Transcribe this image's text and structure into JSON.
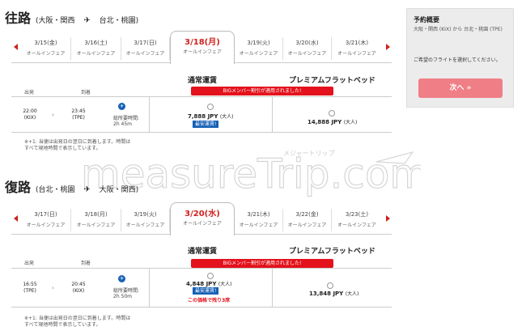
{
  "outbound": {
    "title": "往路",
    "from": "(大阪・関西",
    "arrow": "✈",
    "to": "台北・桃園)",
    "dates": [
      {
        "date": "3/15(金)",
        "fare": "オールインフェア"
      },
      {
        "date": "3/16(土)",
        "fare": "オールインフェア"
      },
      {
        "date": "3/17(日)",
        "fare": "オールインフェア"
      },
      {
        "date": "3/18(月)",
        "fare": "オールインフェア"
      },
      {
        "date": "3/19(火)",
        "fare": "オールインフェア"
      },
      {
        "date": "3/20(水)",
        "fare": "オールインフェア"
      },
      {
        "date": "3/21(木)",
        "fare": "オールインフェア"
      }
    ],
    "fare_normal": "通常運賃",
    "fare_flat": "プレミアムフラットベッド",
    "col_depart": "出発",
    "col_arrive": "到着",
    "promo": "BIGメンバー割引が適用されました!",
    "depart_time": "22:00",
    "depart_code": "(KIX)",
    "arrive_time": "23:45",
    "arrive_code": "(TPE)",
    "dur_label": "総所要時間:",
    "dur_value": "2h 45m",
    "price_normal": "7,888 JPY",
    "price_normal_unit": "(大人)",
    "badge": "最安運賃!",
    "price_flat": "14,888 JPY",
    "price_flat_unit": "(大人)",
    "note_line1": "※+1: 当便は出発日の翌日に到着します。時間は",
    "note_line2": "すべて現地時間で表示しています。"
  },
  "return": {
    "title": "復路",
    "from": "(台北・桃園",
    "arrow": "✈",
    "to": "大阪・関西)",
    "dates": [
      {
        "date": "3/17(日)",
        "fare": "オールインフェア"
      },
      {
        "date": "3/18(月)",
        "fare": "オールインフェア"
      },
      {
        "date": "3/19(火)",
        "fare": "オールインフェア"
      },
      {
        "date": "3/20(水)",
        "fare": "オールインフェア"
      },
      {
        "date": "3/21(木)",
        "fare": "オールインフェア"
      },
      {
        "date": "3/22(金)",
        "fare": "オールインフェア"
      },
      {
        "date": "3/23(土)",
        "fare": "オールインフェア"
      }
    ],
    "fare_normal": "通常運賃",
    "fare_flat": "プレミアムフラットベッド",
    "col_depart": "出発",
    "col_arrive": "到着",
    "promo": "BIGメンバー割引が適用されました!",
    "depart_time": "16:55",
    "depart_code": "(TPE)",
    "arrive_time": "20:45",
    "arrive_code": "(KIX)",
    "dur_label": "総所要時間:",
    "dur_value": "2h 50m",
    "price_normal": "4,848 JPY",
    "price_normal_unit": "(大人)",
    "badge": "最安運賃!",
    "seats_left": "この価格で残り3席",
    "price_flat": "13,848 JPY",
    "price_flat_unit": "(大人)",
    "note_line1": "※+1: 当便は出発日の翌日に到着します。時間は",
    "note_line2": "すべて現地時間で表示しています。"
  },
  "summary": {
    "title": "予約概要",
    "route": "大阪・関西 (KIX) から 台北・桃園 (TPE)",
    "message": "ご希望のフライトを選択してください。",
    "next": "次へ »"
  },
  "watermark": {
    "text": "measureTrip.com",
    "sub": "メジャートリップ"
  },
  "colors": {
    "accent_red": "#d0201c",
    "promo_red": "#e3121c",
    "badge_blue": "#1560b5",
    "next_button": "#f07e86"
  }
}
